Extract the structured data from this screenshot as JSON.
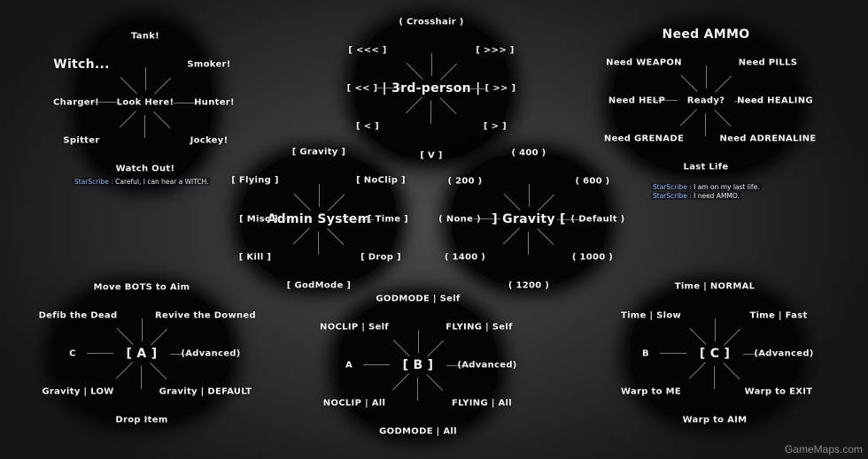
{
  "menus": [
    {
      "id": "warnings",
      "center": "Look Here!",
      "center_large": false,
      "items": {
        "n": "Tank!",
        "ne": "Smoker!",
        "e": "Hunter!",
        "se": "Jockey!",
        "s": "Watch Out!",
        "sw": "Spitter",
        "w": "Charger!",
        "nw": "Witch..."
      }
    },
    {
      "id": "camera",
      "center": "| 3rd-person |",
      "center_large": true,
      "items": {
        "n": "( Crosshair )",
        "ne": "[ >>> ]",
        "e": "[ >> ]",
        "se": "[ > ]",
        "s": "[ V ]",
        "sw": "[ < ]",
        "w": "[ << ]",
        "nw": "[ <<< ]"
      }
    },
    {
      "id": "requests",
      "center": "Ready?",
      "center_large": false,
      "items": {
        "n": "Need AMMO",
        "ne": "Need PILLS",
        "e": "Need HEALING",
        "se": "Need ADRENALINE",
        "s": "Last Life",
        "sw": "Need GRENADE",
        "w": "Need HELP",
        "nw": "Need WEAPON"
      }
    },
    {
      "id": "admin",
      "center": "Admin System",
      "center_large": true,
      "items": {
        "n": "[ Gravity ]",
        "ne": "[ NoClip ]",
        "e": "[ Time ]",
        "se": "[ Drop ]",
        "s": "[ GodMode ]",
        "sw": "[ Kill ]",
        "w": "[ Misc ]",
        "nw": "[ Flying ]"
      }
    },
    {
      "id": "gravity",
      "center": "] Gravity [",
      "center_large": true,
      "items": {
        "n": "( 400 )",
        "ne": "( 600 )",
        "e": "( Default )",
        "se": "( 1000 )",
        "s": "( 1200 )",
        "sw": "( 1400 )",
        "w": "( None )",
        "nw": "( 200 )"
      }
    },
    {
      "id": "menu-a",
      "center": "[ A ]",
      "center_large": true,
      "items": {
        "n": "Move BOTS to Aim",
        "ne": "Revive the Downed",
        "e": "(Advanced)",
        "se": "Gravity | DEFAULT",
        "s": "Drop Item",
        "sw": "Gravity | LOW",
        "w": "C",
        "nw": "Defib the Dead"
      }
    },
    {
      "id": "menu-b",
      "center": "[ B ]",
      "center_large": true,
      "items": {
        "n": "GODMODE | Self",
        "ne": "FLYING | Self",
        "e": "(Advanced)",
        "se": "FLYING | All",
        "s": "GODMODE | All",
        "sw": "NOCLIP | All",
        "w": "A",
        "nw": "NOCLIP | Self"
      }
    },
    {
      "id": "menu-c",
      "center": "[ C ]",
      "center_large": true,
      "items": {
        "n": "Time | NORMAL",
        "ne": "Time | Fast",
        "e": "(Advanced)",
        "se": "Warp to EXIT",
        "s": "Warp to AIM",
        "sw": "Warp to ME",
        "w": "B",
        "nw": "Time | Slow"
      }
    }
  ],
  "chat": {
    "warnings": [
      {
        "name": "StarScribe :",
        "msg": "Careful, I can hear a WITCH."
      }
    ],
    "requests": [
      {
        "name": "StarScribe :",
        "msg": "I am on my last life."
      },
      {
        "name": "StarScribe :",
        "msg": "I need AMMO."
      }
    ]
  },
  "watermark": "GameMaps.com"
}
